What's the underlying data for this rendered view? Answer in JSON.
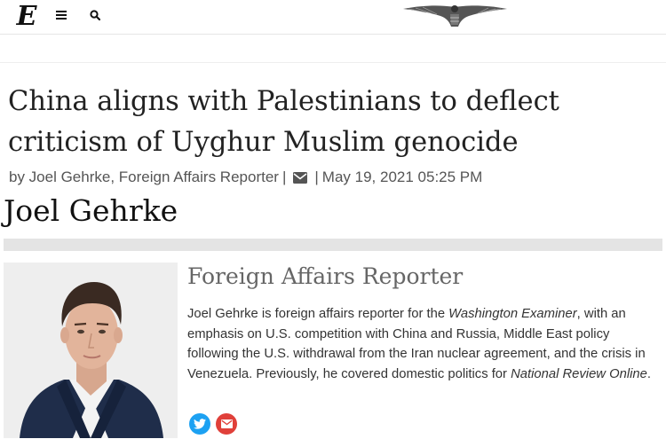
{
  "header": {
    "logo_letter": "E",
    "logo_icon": "gothic-e-logo",
    "menu_icon": "hamburger-icon",
    "search_icon": "magnifier-icon",
    "emblem_icon": "eagle-emblem"
  },
  "article": {
    "headline": "China aligns with Palestinians to deflect criticism of Uyghur Muslim genocide",
    "byline_author": "by Joel Gehrke, Foreign Affairs Reporter",
    "byline_sep1": "|",
    "byline_sep2": "|",
    "byline_date": "May 19, 2021 05:25 PM"
  },
  "author": {
    "name": "Joel Gehrke",
    "role": "Foreign Affairs Reporter",
    "bio_1": "Joel Gehrke is foreign affairs reporter for the ",
    "bio_em1": "Washington Examiner",
    "bio_2": ", with an emphasis on U.S. competition with China and Russia, Middle East policy following the U.S. withdrawal from the Iran nuclear agreement, and the crisis in Venezuela. Previously, he covered domestic politics for ",
    "bio_em2": "National Review Online",
    "bio_3": ".",
    "social": [
      "twitter-icon",
      "email-icon"
    ]
  },
  "colors": {
    "twitter": "#1da1f2",
    "email": "#e0403a",
    "suit": "#1f2d4a",
    "gray_bar": "#e4e4e4"
  }
}
